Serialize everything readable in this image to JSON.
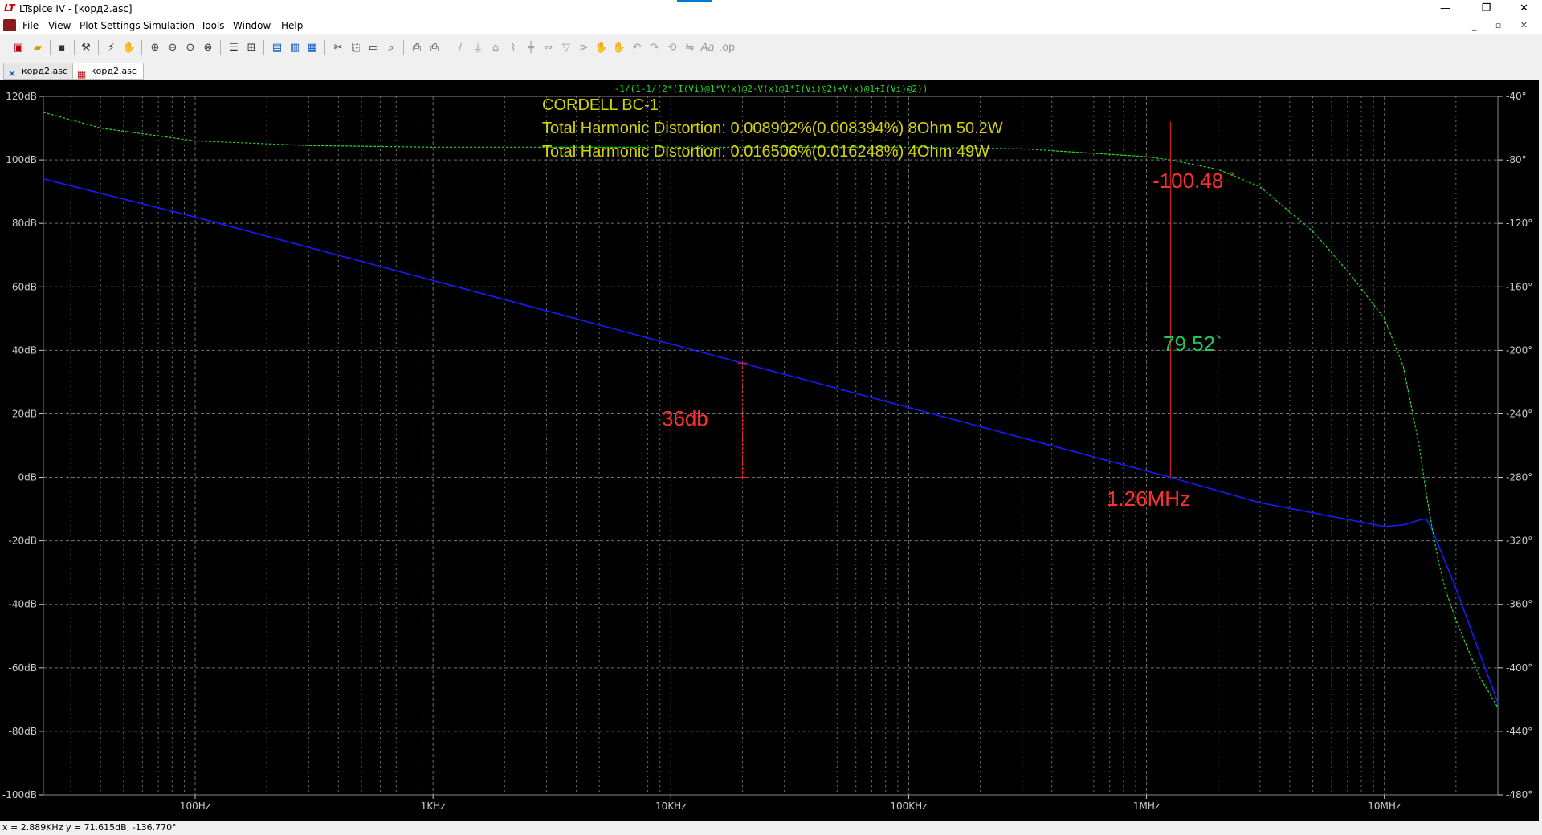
{
  "window": {
    "title": "LTspice IV - [корд2.asc]",
    "app_icon_text": "LT"
  },
  "menu": [
    "File",
    "View",
    "Plot Settings",
    "Simulation",
    "Tools",
    "Window",
    "Help"
  ],
  "tabs": [
    {
      "label": "корд2.asc",
      "icon": "schematic-icon",
      "active": false
    },
    {
      "label": "корд2.asc",
      "icon": "waveform-icon",
      "active": true
    }
  ],
  "toolbar_icons": [
    "new-schematic",
    "open",
    "save",
    "control-panel",
    "run",
    "halt",
    "zoom-in",
    "zoom-out",
    "zoom-fit",
    "zoom-cancel",
    "tile-horizontal",
    "tile-vertical",
    "cascade",
    "cut",
    "copy",
    "paste",
    "find",
    "print-preview",
    "print",
    "draw-wire",
    "ground",
    "label",
    "resistor",
    "capacitor",
    "inductor",
    "diode",
    "component",
    "move",
    "drag",
    "undo",
    "redo",
    "rotate",
    "mirror",
    "text",
    "spice-directive"
  ],
  "plot": {
    "expression": "-1/(1-1/(2*(I(Vi)@1*V(x)@2-V(x)@1*I(Vi)@2)+V(x)@1+I(Vi)@2))",
    "annotations": [
      {
        "text": "CORDELL BC-1",
        "color": "#d4d400"
      },
      {
        "text": "Total Harmonic Distortion: 0.008902%(0.008394%)  8Ohm 50.2W",
        "color": "#d4d400"
      },
      {
        "text": "Total Harmonic Distortion: 0.016506%(0.016248%)  4Ohm 49W",
        "color": "#d4d400"
      },
      {
        "text": "-100.48 `",
        "color": "#ff3030"
      },
      {
        "text": "79.52`",
        "color": "#22c55e"
      },
      {
        "text": "36db",
        "color": "#ff3030"
      },
      {
        "text": "1.26MHz",
        "color": "#ff3030"
      }
    ],
    "colors": {
      "background": "#000000",
      "grid": "#6e6e6e",
      "magnitude": "#1a1aff",
      "phase": "#22dd22",
      "marker": "#ff2020",
      "axis_text": "#cccccc"
    },
    "x_ticks": [
      "100Hz",
      "1KHz",
      "10KHz",
      "100KHz",
      "1MHz",
      "10MHz"
    ],
    "y_left_ticks": [
      "120dB",
      "100dB",
      "80dB",
      "60dB",
      "40dB",
      "20dB",
      "0dB",
      "-20dB",
      "-40dB",
      "-60dB",
      "-80dB",
      "-100dB"
    ],
    "y_right_ticks": [
      "-40°",
      "-80°",
      "-120°",
      "-160°",
      "-200°",
      "-240°",
      "-280°",
      "-320°",
      "-360°",
      "-400°",
      "-440°",
      "-480°"
    ]
  },
  "chart_data": {
    "type": "line",
    "x_scale": "log",
    "xlim_hz": [
      23,
      30000000
    ],
    "ylim_left_db": [
      -100,
      120
    ],
    "ylim_right_deg": [
      -480,
      -40
    ],
    "series": [
      {
        "axis": "left",
        "style": "solid",
        "x": [
          23,
          100,
          1000,
          10000,
          100000,
          1000000,
          1260000,
          3000000,
          10000000,
          12000000,
          14000000,
          15000000,
          16000000,
          17000000,
          20000000,
          30000000
        ],
        "y": [
          94,
          82,
          62,
          42,
          22,
          2,
          0,
          -8,
          -15.5,
          -15,
          -13.5,
          -13,
          -17,
          -22,
          -35,
          -71
        ]
      },
      {
        "axis": "right",
        "style": "dashed",
        "x": [
          23,
          40,
          100,
          300,
          1000,
          10000,
          100000,
          300000,
          1000000,
          1260000,
          2000000,
          3000000,
          5000000,
          7000000,
          10000000,
          12000000,
          14000000,
          15000000,
          16000000,
          17000000,
          18000000,
          20000000,
          25000000,
          30000000
        ],
        "y": [
          -50,
          -60,
          -68,
          -71,
          -72,
          -72,
          -72,
          -73,
          -78,
          -80,
          -86,
          -97,
          -125,
          -150,
          -180,
          -210,
          -260,
          -290,
          -315,
          -335,
          -350,
          -370,
          -405,
          -425
        ]
      }
    ]
  },
  "status": {
    "text": "x = 2.889KHz    y = 71.615dB, -136.770°"
  }
}
